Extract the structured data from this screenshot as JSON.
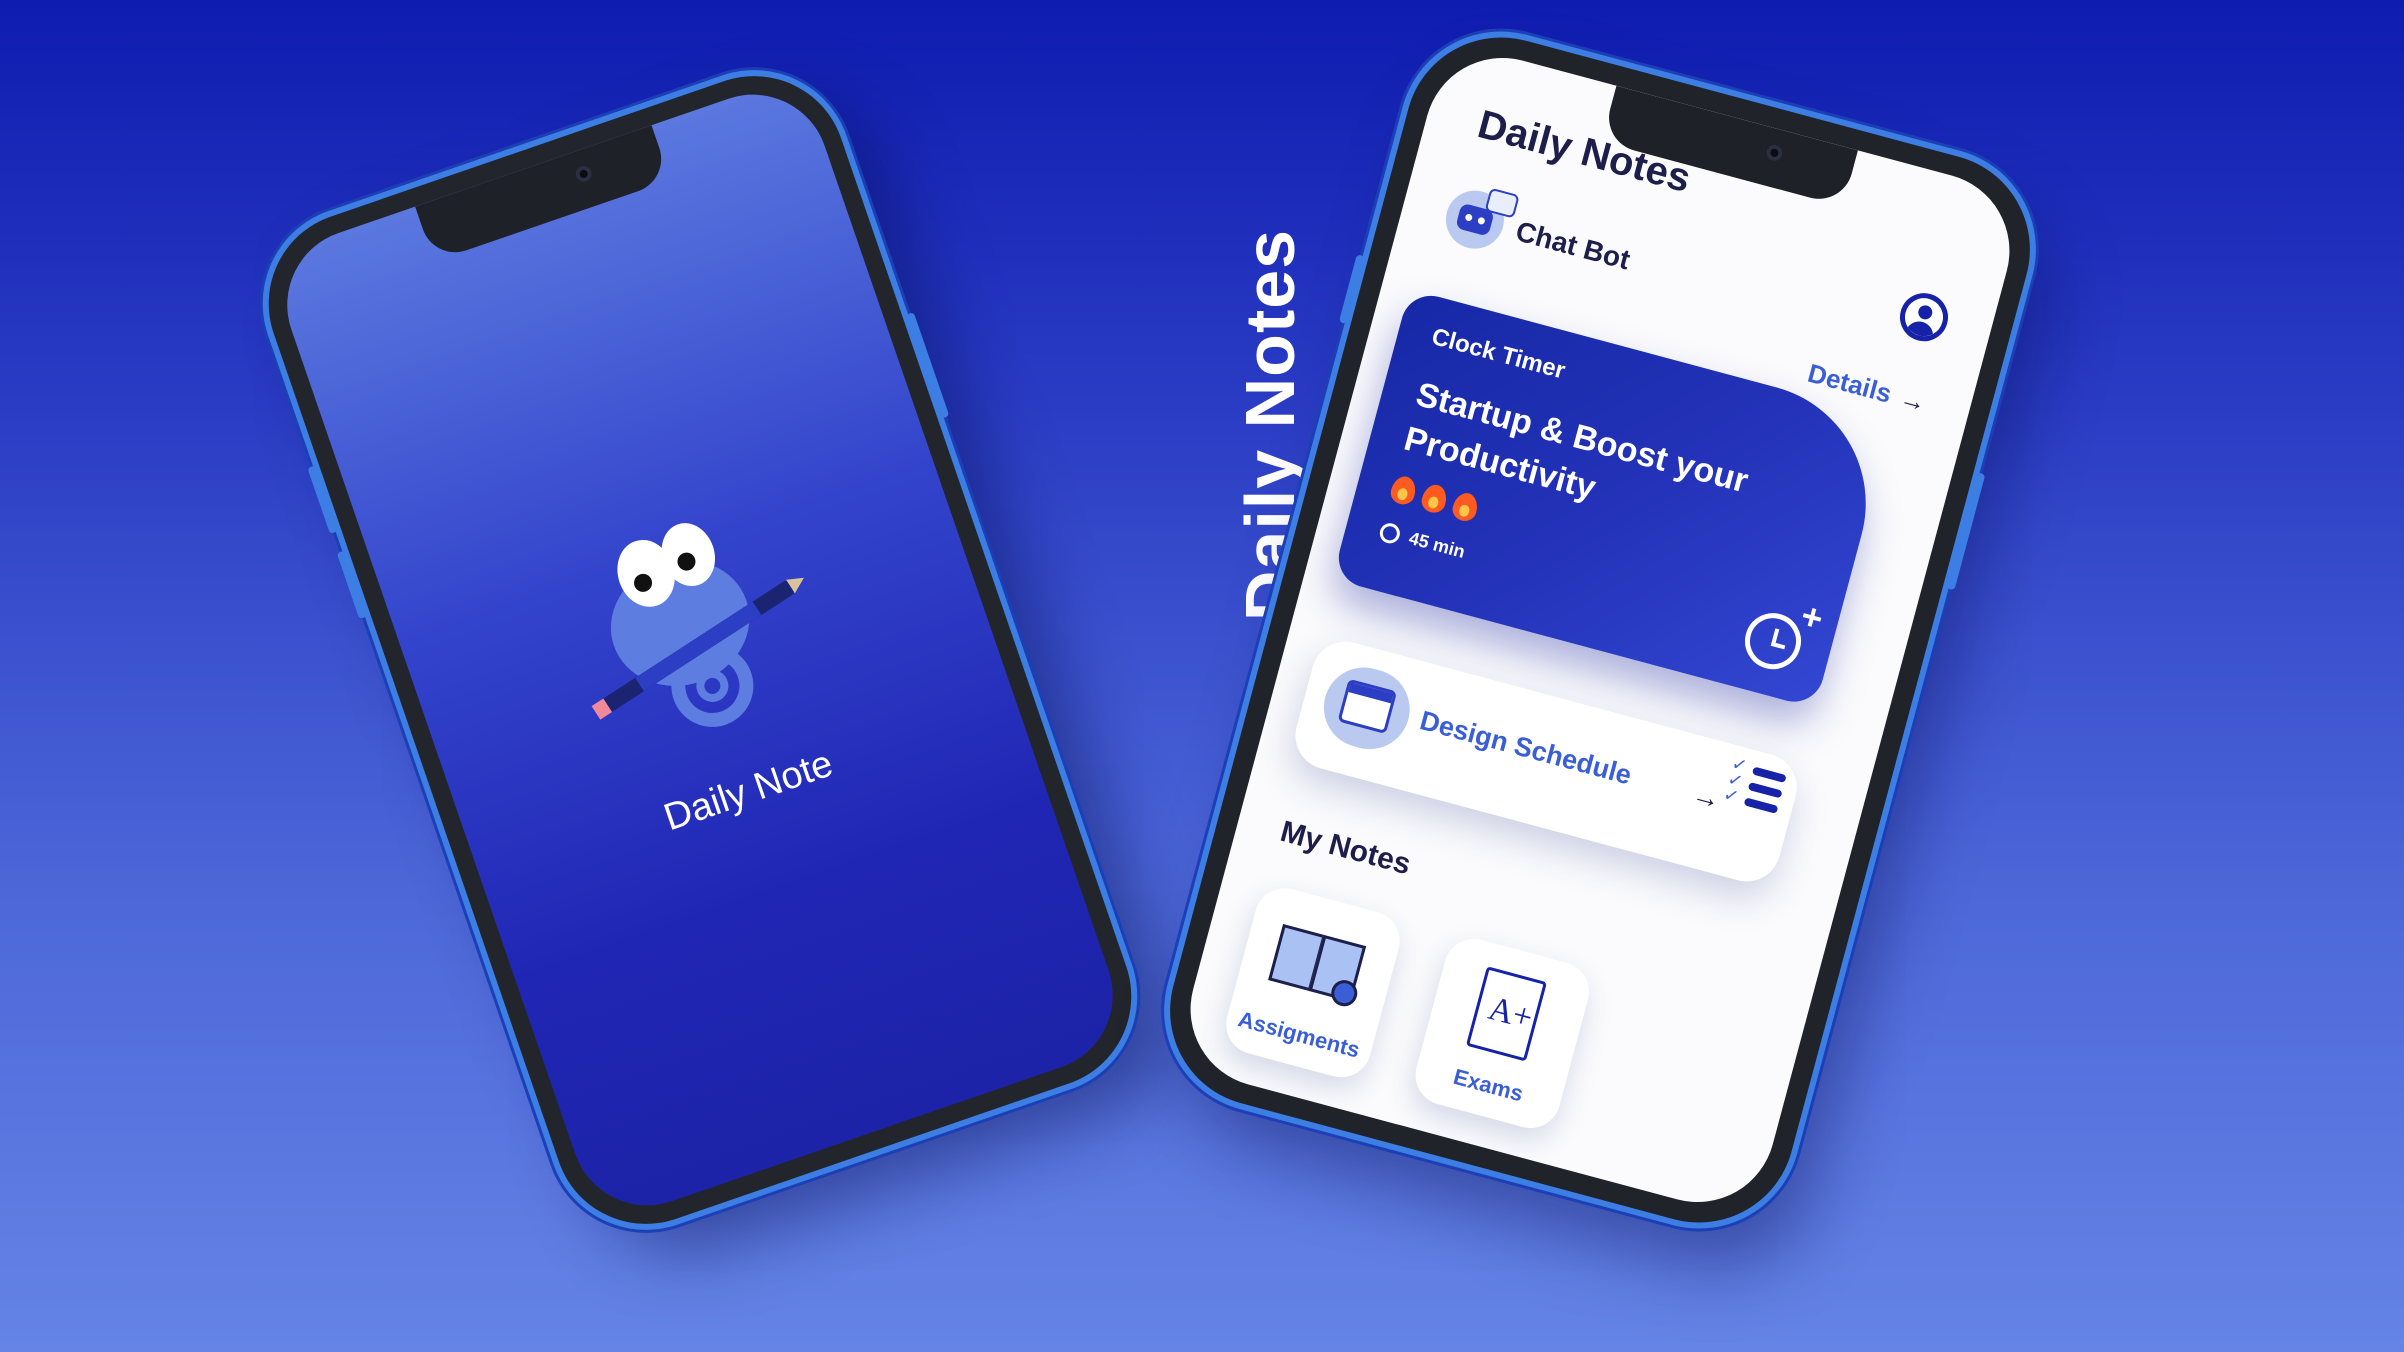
{
  "showcase": {
    "vertical_title": "Daily Notes"
  },
  "splash_phone": {
    "title": "Daily Note",
    "mascot_icon": "chameleon-with-pencil-icon"
  },
  "home_phone": {
    "app_title": "Daily Notes",
    "profile_icon": "user-profile-icon",
    "chatbot": {
      "label": "Chat Bot",
      "icon": "chatbot-icon"
    },
    "details_link": {
      "label": "Details",
      "arrow": "→"
    },
    "timer_card": {
      "kicker": "Clock Timer",
      "headline": "Startup & Boost your Productivity",
      "fire_count": 3,
      "duration": "45 min",
      "action_icon": "clock-add-icon"
    },
    "schedule_card": {
      "label": "Design Schedule",
      "arrow": "→",
      "icon": "calendar-icon"
    },
    "notes_heading": "My Notes",
    "notes": [
      {
        "label": "Assigments",
        "icon": "open-book-icon"
      },
      {
        "label": "Exams",
        "icon": "graded-document-icon"
      }
    ]
  },
  "colors": {
    "background_top": "#0f1cb0",
    "background_bottom": "#6584e6",
    "accent": "#3a5ed6",
    "dark_text": "#1d1f4a",
    "fire": "#ff5a1f"
  }
}
